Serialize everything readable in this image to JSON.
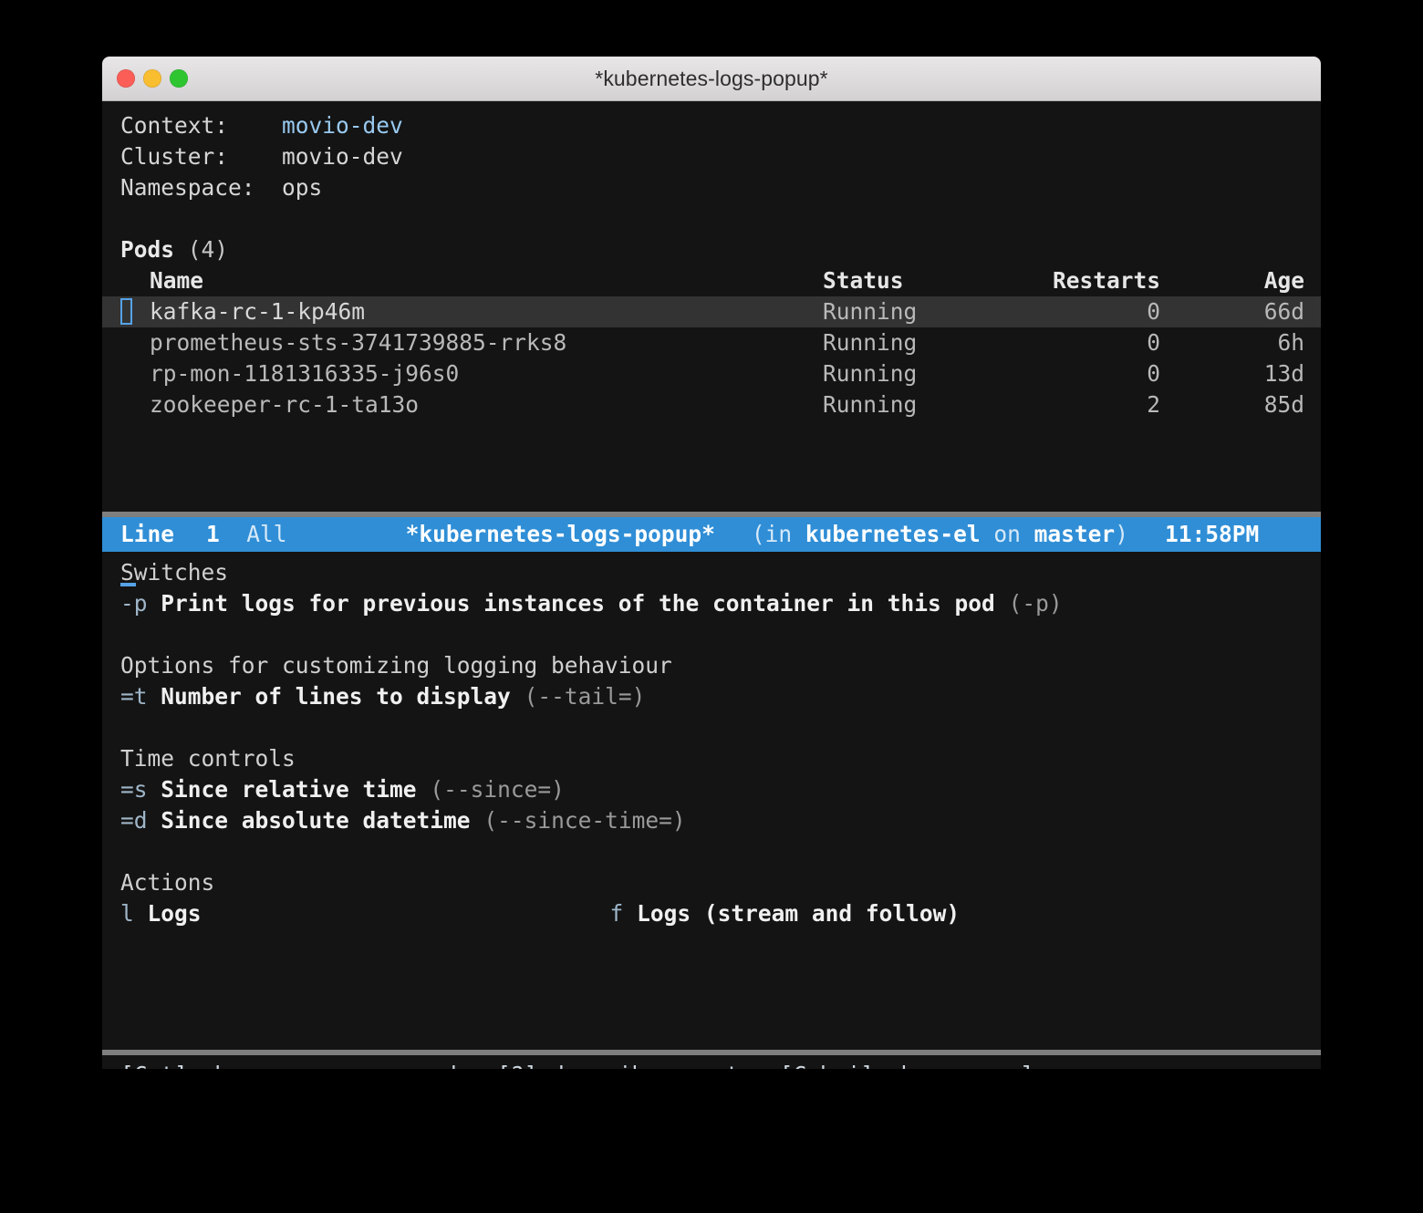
{
  "window": {
    "title": "*kubernetes-logs-popup*",
    "controls": [
      "close-button",
      "minimize-button",
      "zoom-button"
    ],
    "colors": {
      "close": "#fa5e57",
      "minimize": "#f9bd30",
      "zoom": "#2fc531",
      "accent": "#2f8ed6",
      "cursor": "#55a3e8",
      "background": "#141414",
      "selection": "#333333"
    }
  },
  "overview": {
    "context_label": "Context:",
    "context_value": "movio-dev",
    "cluster_label": "Cluster:",
    "cluster_value": "movio-dev",
    "namespace_label": "Namespace:",
    "namespace_value": "ops"
  },
  "pods": {
    "section_title": "Pods",
    "section_count": "(4)",
    "columns": [
      "Name",
      "Status",
      "Restarts",
      "Age"
    ],
    "rows": [
      {
        "name": "kafka-rc-1-kp46m",
        "status": "Running",
        "restarts": "0",
        "age": "66d",
        "selected": true
      },
      {
        "name": "prometheus-sts-3741739885-rrks8",
        "status": "Running",
        "restarts": "0",
        "age": "6h",
        "selected": false
      },
      {
        "name": "rp-mon-1181316335-j96s0",
        "status": "Running",
        "restarts": "0",
        "age": "13d",
        "selected": false
      },
      {
        "name": "zookeeper-rc-1-ta13o",
        "status": "Running",
        "restarts": "2",
        "age": "85d",
        "selected": false
      }
    ]
  },
  "modeline": {
    "line_label": "Line",
    "line_number": "1",
    "scroll_position": "All",
    "buffer_name": "*kubernetes-logs-popup*",
    "in_word": "(in",
    "project": "kubernetes-el",
    "on_word": "on",
    "branch": "master",
    "close_paren": ")",
    "time": "11:58PM"
  },
  "popup": {
    "groups": [
      {
        "title": "Switches",
        "underlined": true,
        "items": [
          {
            "key": "-p",
            "desc": "Print logs for previous instances of the container in this pod",
            "hint": "(-p)"
          }
        ]
      },
      {
        "title": "Options for customizing logging behaviour",
        "underlined": false,
        "items": [
          {
            "key": "=t",
            "desc": "Number of lines to display",
            "hint": "(--tail=)"
          }
        ]
      },
      {
        "title": "Time controls",
        "underlined": false,
        "items": [
          {
            "key": "=s",
            "desc": "Since relative time",
            "hint": "(--since=)"
          },
          {
            "key": "=d",
            "desc": "Since absolute datetime",
            "hint": "(--since-time=)"
          }
        ]
      },
      {
        "title": "Actions",
        "underlined": false,
        "items": [
          {
            "key": "l",
            "desc": "Logs",
            "hint": ""
          },
          {
            "key": "f",
            "desc": "Logs (stream and follow)",
            "hint": "",
            "column": 2
          }
        ]
      }
    ]
  },
  "echo": {
    "text": "[C-t] show common commands, [?] describe events, [C-h i] show manual"
  }
}
